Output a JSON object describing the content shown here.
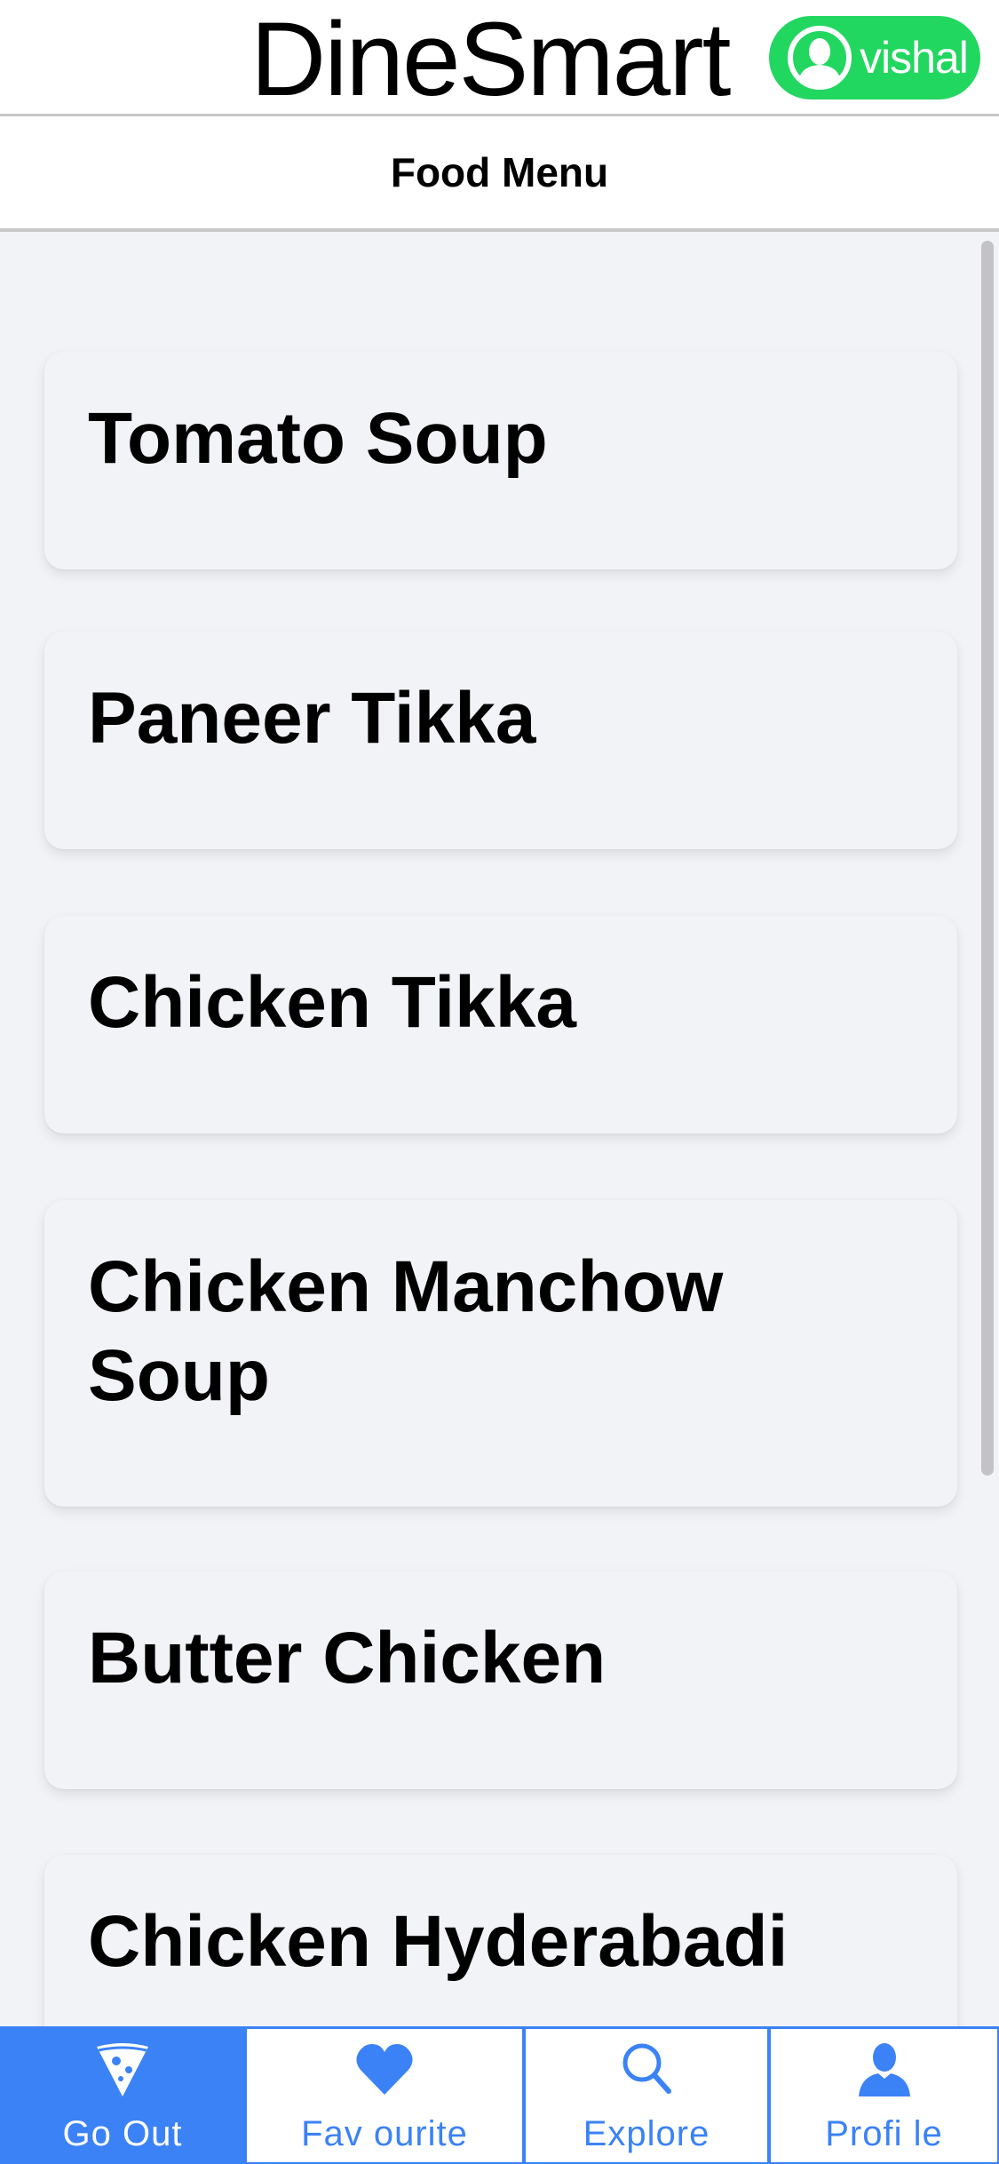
{
  "header": {
    "brand": "DineSmart",
    "user_name": "vishal"
  },
  "subheader": {
    "title": "Food Menu"
  },
  "menu": {
    "items": [
      {
        "name": "Tomato Soup"
      },
      {
        "name": "Paneer Tikka"
      },
      {
        "name": "Chicken Tikka"
      },
      {
        "name": "Chicken Manchow Soup"
      },
      {
        "name": "Butter Chicken"
      },
      {
        "name": "Chicken Hyderabadi"
      }
    ]
  },
  "tabbar": {
    "tabs": [
      {
        "label": "Go Out",
        "icon": "pizza-slice-icon",
        "active": true
      },
      {
        "label": "Fav ourite",
        "icon": "heart-icon",
        "active": false
      },
      {
        "label": "Explore",
        "icon": "search-icon",
        "active": false
      },
      {
        "label": "Profi le",
        "icon": "person-icon",
        "active": false
      }
    ]
  },
  "colors": {
    "accent": "#3b82f6",
    "user_badge": "#22d75f",
    "content_bg": "#f2f3f7"
  }
}
